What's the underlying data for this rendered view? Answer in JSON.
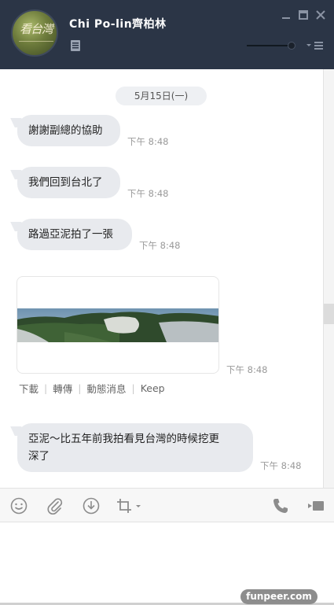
{
  "header": {
    "contact_name": "Chi Po-lin齊柏林",
    "avatar_text": "看台灣",
    "bg_color": "#2b3546"
  },
  "chat": {
    "date_separator": "5月15日(一)",
    "messages": [
      {
        "text": "謝謝副總的協助",
        "time": "下午 8:48"
      },
      {
        "text": "我們回到台北了",
        "time": "下午 8:48"
      },
      {
        "text": "路過亞泥拍了一張",
        "time": "下午 8:48"
      },
      {
        "type": "image",
        "time": "下午 8:48"
      },
      {
        "text_line1": "亞泥～比五年前我拍看見台灣的時候挖更",
        "text_line2": "深了",
        "time": "下午 8:48"
      }
    ],
    "image_actions": [
      "下載",
      "轉傳",
      "動態消息",
      "Keep"
    ]
  },
  "toolbar": {
    "icons": [
      "emoji-icon",
      "attachment-icon",
      "download-icon",
      "crop-icon",
      "phone-icon",
      "video-icon"
    ]
  },
  "watermark": "funpeer.com"
}
